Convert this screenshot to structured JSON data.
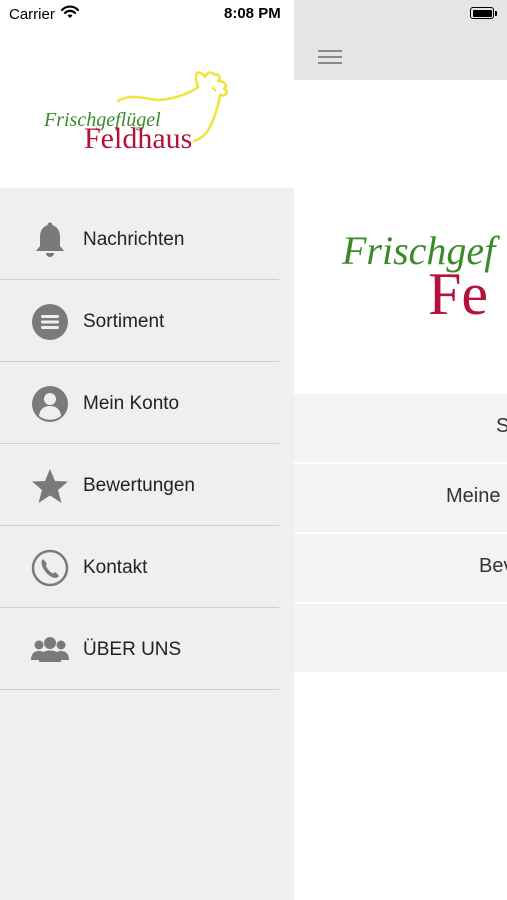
{
  "status_bar": {
    "carrier": "Carrier",
    "time": "8:08 PM"
  },
  "drawer": {
    "logo": {
      "line1": "Frischgeflügel",
      "line2": "Feldhaus"
    },
    "menu": [
      {
        "label": "Nachrichten",
        "icon": "bell-icon"
      },
      {
        "label": "Sortiment",
        "icon": "list-icon"
      },
      {
        "label": "Mein Konto",
        "icon": "user-icon"
      },
      {
        "label": "Bewertungen",
        "icon": "star-icon"
      },
      {
        "label": "Kontakt",
        "icon": "phone-icon"
      },
      {
        "label": "ÜBER UNS",
        "icon": "group-icon"
      }
    ]
  },
  "main": {
    "logo": {
      "line1": "Frischgef",
      "line2": "Fe"
    },
    "buttons": [
      {
        "label": "S"
      },
      {
        "label": "Meine"
      },
      {
        "label": "Bev"
      },
      {
        "label": ""
      }
    ]
  },
  "colors": {
    "logo_green": "#3a8a2a",
    "logo_red": "#b5123a",
    "logo_yellow": "#f2e23a",
    "icon_gray": "#7a7a7a"
  }
}
